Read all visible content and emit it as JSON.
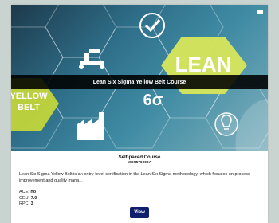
{
  "course": {
    "title": "Lean Six Sigma Yellow Belt Course",
    "type": "Self-paced Course",
    "code": "MCS570002A",
    "description": "Lean Six Sigma Yellow Belt is an entry-level certification in the Lean Six Sigma methodology, which focuses on process improvement and quality mana...",
    "ace_label": "ACE:",
    "ace_value": "no",
    "ceu_label": "CEU:",
    "ceu_value": "7.0",
    "rpc_label": "RPC:",
    "rpc_value": "3",
    "view_label": "View"
  },
  "hero": {
    "lean_text": "LEAN",
    "yellow_text": "YELLOW",
    "belt_text": "BELT",
    "sigma_text": "6σ"
  },
  "colors": {
    "lean_hex": "#d7e65a",
    "yellow_belt_hex": "#c2d53a",
    "button": "#0f1f6e",
    "title_bar": "#000000"
  },
  "icons": [
    "bookmark-icon",
    "check-icon",
    "factory-icon",
    "robot-arm-icon",
    "lightbulb-icon"
  ]
}
